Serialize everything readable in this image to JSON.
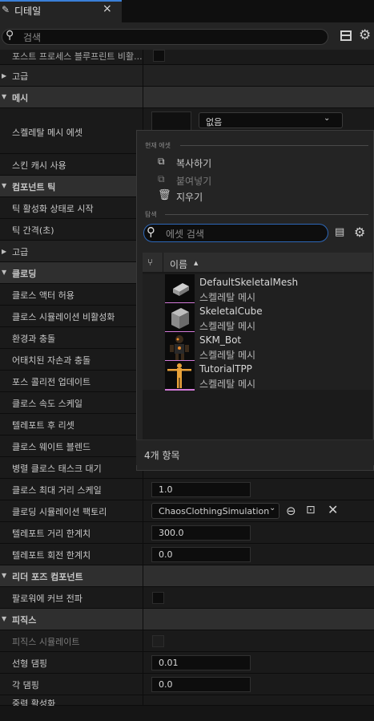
{
  "tab": {
    "title": "디테일",
    "close": "×"
  },
  "search": {
    "placeholder": "검색"
  },
  "rows": {
    "postprocess": "포스트 프로세스 블루프린트 비활...",
    "advanced1": "고급",
    "mesh": "메시",
    "skeletal_mesh_asset": "스켈레탈 메시 에셋",
    "skin_cache": "스킨 캐시 사용",
    "component_tick": "컴포넌트 틱",
    "tick_start": "틱 활성화 상태로 시작",
    "tick_interval": "틱 간격(초)",
    "advanced2": "고급",
    "clothing": "클로딩",
    "allow_cloth_actors": "클로스 액터 허용",
    "disable_cloth_sim": "클로스 시뮬레이션 비활성화",
    "env_collision": "환경과 충돌",
    "attached_pose": "어태치된 자손과 충돌",
    "force_collision_update": "포스 콜리전 업데이트",
    "cloth_velocity_scale": "클로스 속도 스케일",
    "reset_after_teleport": "텔레포트 후 리셋",
    "cloth_weight_blend": "클로스 웨이트 블렌드",
    "parallel_cloth_wait": "병렬 클로스 태스크 대기",
    "cloth_max_distance": "클로스 최대 거리 스케일",
    "clothing_sim_factory": "클로딩 시뮬레이션 팩토리",
    "teleport_distance": "텔레포트 거리 한계치",
    "teleport_rotation": "텔레포트 회전 한계치",
    "leader_pose": "리더 포즈 컴포넌트",
    "propagate_curves": "팔로워에 커브 전파",
    "physics": "피직스",
    "simulate_physics": "피직스 시뮬레이트",
    "linear_damping": "선형 댐핑",
    "angular_damping": "각 댐핑",
    "cut_row": "중력 활성화"
  },
  "values": {
    "mesh_none": "없음",
    "cloth_max_distance": "1.0",
    "clothing_factory": "ChaosClothingSimulation",
    "teleport_distance": "300.0",
    "teleport_rotation": "0.0",
    "linear_damping": "0.01",
    "angular_damping": "0.0"
  },
  "popup": {
    "current_asset": "현재 에셋",
    "copy": "복사하기",
    "paste": "붙여넣기",
    "clear": "지우기",
    "browse": "탐색",
    "asset_search_placeholder": "에셋 검색",
    "col_name": "이름",
    "sort_icon": "▲",
    "assets": [
      {
        "name": "DefaultSkeletalMesh",
        "type": "스켈레탈 메시"
      },
      {
        "name": "SkeletalCube",
        "type": "스켈레탈 메시"
      },
      {
        "name": "SKM_Bot",
        "type": "스켈레탈 메시"
      },
      {
        "name": "TutorialTPP",
        "type": "스켈레탈 메시"
      }
    ],
    "item_count": "4개 항목"
  }
}
